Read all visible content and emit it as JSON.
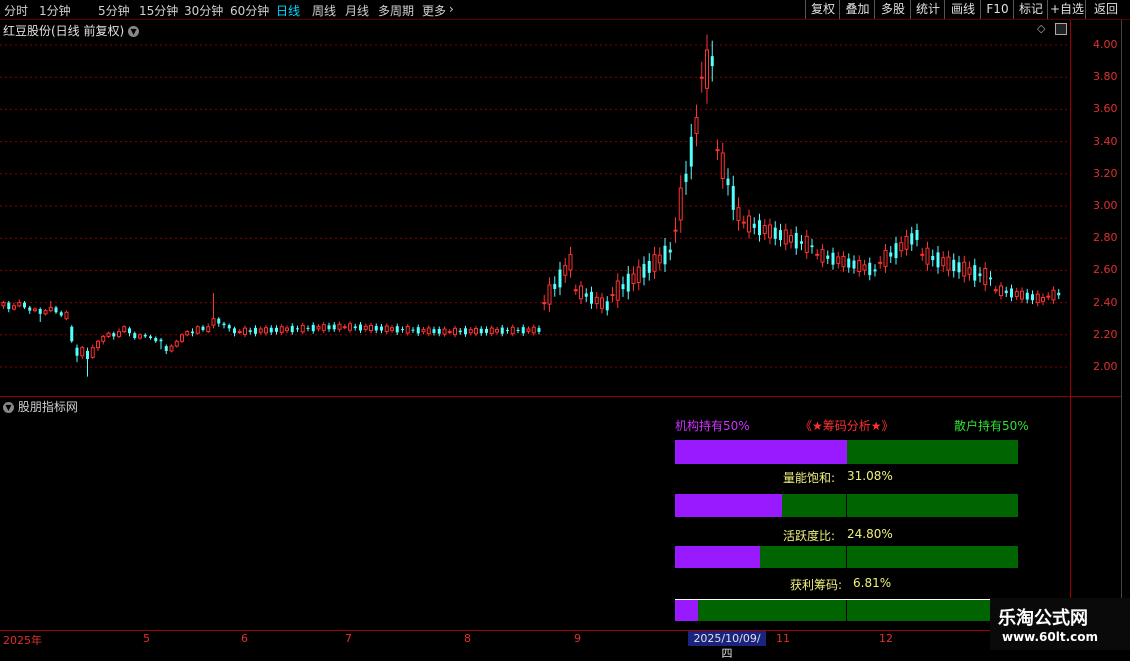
{
  "toolbar": {
    "periods": [
      "分时",
      "1分钟",
      "5分钟",
      "15分钟",
      "30分钟",
      "60分钟",
      "日线",
      "周线",
      "月线",
      "多周期",
      "更多"
    ],
    "active_period": "日线",
    "right_buttons": [
      "复权",
      "叠加",
      "多股",
      "统计",
      "画线",
      "F10",
      "标记",
      "+自选",
      "返回"
    ]
  },
  "stock": {
    "title": "红豆股份(日线 前复权)"
  },
  "price_axis": {
    "ticks": [
      "4.00",
      "3.80",
      "3.60",
      "3.40",
      "3.20",
      "3.00",
      "2.80",
      "2.60",
      "2.40",
      "2.20",
      "2.00"
    ]
  },
  "indicator": {
    "name": "股朋指标网",
    "header_left": "机构持有50%",
    "header_center": "《★筹码分析★》",
    "header_right": "散户持有50%",
    "rows": [
      {
        "label": "量能饱和:",
        "value": "31.08%",
        "fill": 0.3108
      },
      {
        "label": "活跃度比:",
        "value": "24.80%",
        "fill": 0.248
      },
      {
        "label": "获利筹码:",
        "value": "6.81%",
        "fill": 0.0681
      }
    ],
    "top_bar_fill": 0.5
  },
  "date_axis": {
    "labels": [
      "2025年",
      "5",
      "6",
      "7",
      "8",
      "9",
      "11",
      "12"
    ],
    "cursor": "2025/10/09/四"
  },
  "watermark": {
    "title": "乐淘公式网",
    "url": "www.60lt.com"
  },
  "colors": {
    "up": "#ff3030",
    "down": "#54ffff",
    "grid": "#8b0000",
    "institution": "#9a1aff",
    "retail": "#006400"
  },
  "chart_data": {
    "type": "candlestick",
    "ylim": [
      1.9,
      4.05
    ],
    "candles": [
      [
        2.38,
        2.4,
        2.36,
        2.41
      ],
      [
        2.4,
        2.36,
        2.34,
        2.41
      ],
      [
        2.36,
        2.38,
        2.35,
        2.4
      ],
      [
        2.38,
        2.4,
        2.37,
        2.42
      ],
      [
        2.4,
        2.37,
        2.36,
        2.41
      ],
      [
        2.37,
        2.35,
        2.33,
        2.38
      ],
      [
        2.35,
        2.36,
        2.34,
        2.37
      ],
      [
        2.36,
        2.33,
        2.28,
        2.37
      ],
      [
        2.33,
        2.35,
        2.32,
        2.36
      ],
      [
        2.35,
        2.37,
        2.34,
        2.41
      ],
      [
        2.37,
        2.34,
        2.33,
        2.38
      ],
      [
        2.34,
        2.32,
        2.31,
        2.35
      ],
      [
        2.3,
        2.34,
        2.29,
        2.35
      ],
      [
        2.25,
        2.16,
        2.15,
        2.26
      ],
      [
        2.12,
        2.07,
        2.03,
        2.14
      ],
      [
        2.07,
        2.12,
        2.05,
        2.13
      ],
      [
        2.1,
        2.05,
        1.94,
        2.12
      ],
      [
        2.06,
        2.12,
        2.05,
        2.14
      ],
      [
        2.12,
        2.16,
        2.1,
        2.17
      ],
      [
        2.16,
        2.19,
        2.14,
        2.2
      ],
      [
        2.19,
        2.21,
        2.18,
        2.22
      ],
      [
        2.21,
        2.19,
        2.17,
        2.22
      ],
      [
        2.19,
        2.22,
        2.18,
        2.24
      ],
      [
        2.22,
        2.25,
        2.21,
        2.26
      ],
      [
        2.24,
        2.21,
        2.19,
        2.25
      ],
      [
        2.21,
        2.18,
        2.17,
        2.22
      ],
      [
        2.18,
        2.2,
        2.17,
        2.21
      ],
      [
        2.2,
        2.19,
        2.18,
        2.21
      ],
      [
        2.19,
        2.18,
        2.17,
        2.2
      ],
      [
        2.18,
        2.16,
        2.15,
        2.19
      ],
      [
        2.17,
        2.16,
        2.11,
        2.18
      ],
      [
        2.13,
        2.1,
        2.08,
        2.14
      ],
      [
        2.1,
        2.13,
        2.09,
        2.14
      ],
      [
        2.13,
        2.16,
        2.12,
        2.17
      ],
      [
        2.16,
        2.2,
        2.15,
        2.21
      ],
      [
        2.2,
        2.22,
        2.19,
        2.23
      ],
      [
        2.22,
        2.21,
        2.19,
        2.24
      ],
      [
        2.21,
        2.25,
        2.2,
        2.26
      ],
      [
        2.25,
        2.23,
        2.22,
        2.26
      ],
      [
        2.22,
        2.25,
        2.21,
        2.27
      ],
      [
        2.26,
        2.3,
        2.24,
        2.46
      ],
      [
        2.3,
        2.27,
        2.25,
        2.31
      ],
      [
        2.27,
        2.26,
        2.24,
        2.28
      ],
      [
        2.26,
        2.24,
        2.22,
        2.27
      ],
      [
        2.24,
        2.21,
        2.19,
        2.25
      ]
    ]
  }
}
